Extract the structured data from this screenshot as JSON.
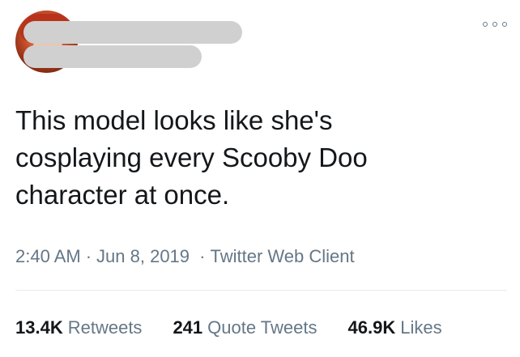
{
  "tweet": {
    "text": "This model looks like she's\ncosplaying every Scooby Doo\ncharacter at once.",
    "time": "2:40 AM",
    "date": "Jun 8, 2019",
    "client": "Twitter Web Client",
    "separator": "·"
  },
  "stats": {
    "retweets": {
      "count": "13.4K",
      "label": "Retweets"
    },
    "quote_tweets": {
      "count": "241",
      "label": "Quote Tweets"
    },
    "likes": {
      "count": "46.9K",
      "label": "Likes"
    }
  },
  "icons": {
    "more": "more-options-icon"
  },
  "colors": {
    "text_primary": "#14171a",
    "text_secondary": "#657786",
    "divider": "#e6ecf0",
    "redaction": "#d0d0d0"
  }
}
